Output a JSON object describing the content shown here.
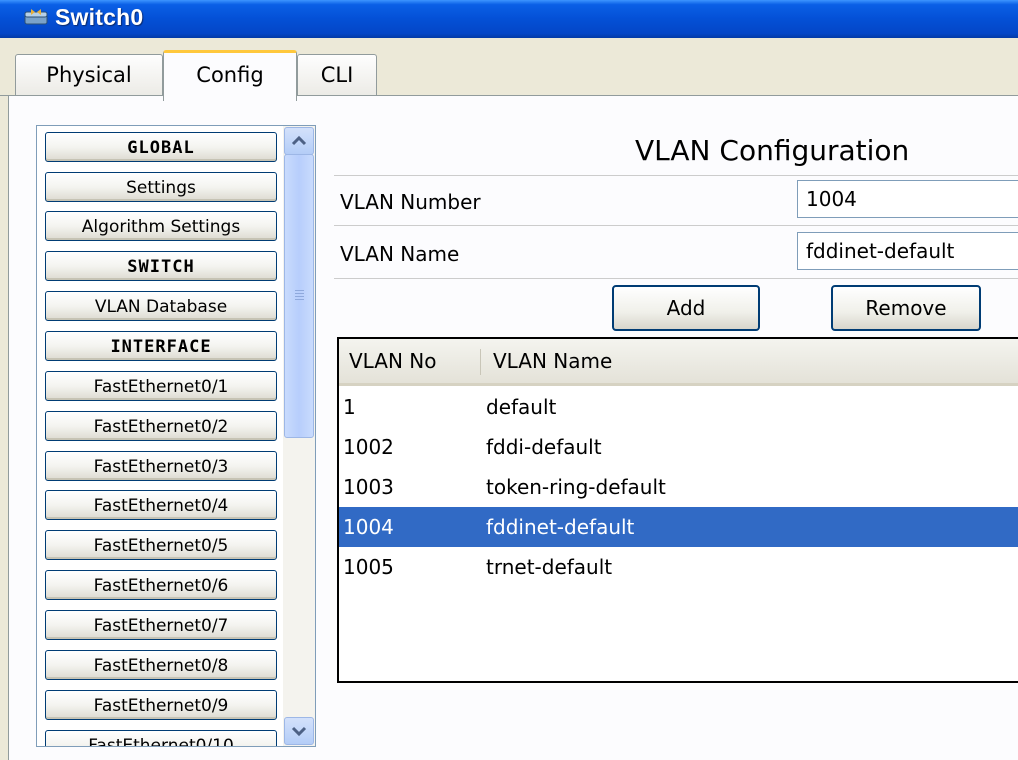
{
  "window": {
    "title": "Switch0",
    "app_icon": "switch-device-icon"
  },
  "tabs": [
    {
      "label": "Physical",
      "active": false
    },
    {
      "label": "Config",
      "active": true
    },
    {
      "label": "CLI",
      "active": false
    }
  ],
  "sidebar": {
    "items": [
      {
        "label": "GLOBAL",
        "header": true
      },
      {
        "label": "Settings"
      },
      {
        "label": "Algorithm Settings"
      },
      {
        "label": "SWITCH",
        "header": true
      },
      {
        "label": "VLAN Database"
      },
      {
        "label": "INTERFACE",
        "header": true
      },
      {
        "label": "FastEthernet0/1"
      },
      {
        "label": "FastEthernet0/2"
      },
      {
        "label": "FastEthernet0/3"
      },
      {
        "label": "FastEthernet0/4"
      },
      {
        "label": "FastEthernet0/5"
      },
      {
        "label": "FastEthernet0/6"
      },
      {
        "label": "FastEthernet0/7"
      },
      {
        "label": "FastEthernet0/8"
      },
      {
        "label": "FastEthernet0/9"
      },
      {
        "label": "FastEthernet0/10"
      }
    ]
  },
  "config": {
    "title": "VLAN Configuration",
    "vlan_number_label": "VLAN Number",
    "vlan_number_value": "1004",
    "vlan_name_label": "VLAN Name",
    "vlan_name_value": "fddinet-default",
    "add_label": "Add",
    "remove_label": "Remove"
  },
  "vlan_table": {
    "columns": [
      "VLAN No",
      "VLAN Name"
    ],
    "rows": [
      {
        "no": "1",
        "name": "default",
        "selected": false
      },
      {
        "no": "1002",
        "name": "fddi-default",
        "selected": false
      },
      {
        "no": "1003",
        "name": "token-ring-default",
        "selected": false
      },
      {
        "no": "1004",
        "name": "fddinet-default",
        "selected": true
      },
      {
        "no": "1005",
        "name": "trnet-default",
        "selected": false
      }
    ]
  },
  "colors": {
    "titlebar": "#0450d6",
    "selection": "#316ac5",
    "active_tab_accent": "#ffc83c"
  }
}
